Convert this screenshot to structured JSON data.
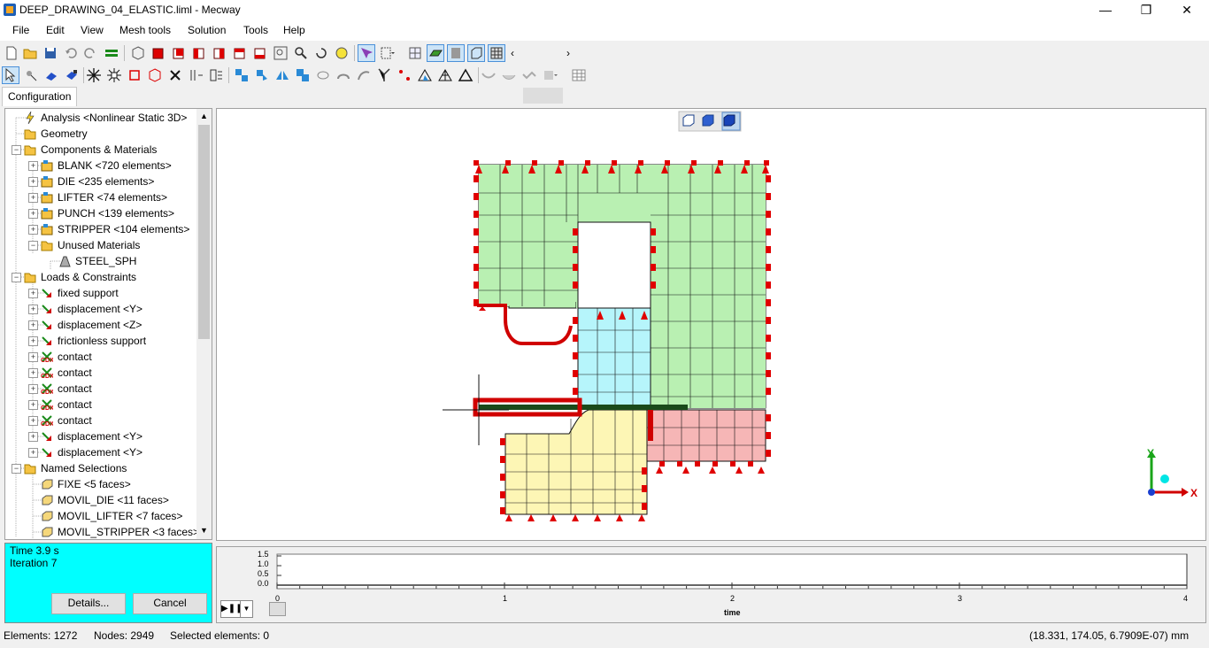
{
  "window": {
    "title": "DEEP_DRAWING_04_ELASTIC.liml - Mecway",
    "minimize": "—",
    "maximize": "❐",
    "close": "✕"
  },
  "menu": [
    "File",
    "Edit",
    "View",
    "Mesh tools",
    "Solution",
    "Tools",
    "Help"
  ],
  "tabs": {
    "configuration": "Configuration"
  },
  "tree": {
    "items": [
      {
        "label": "Analysis <Nonlinear Static 3D>",
        "icon": "lightning-icon"
      },
      {
        "label": "Geometry",
        "icon": "folder-icon"
      },
      {
        "label": "Components & Materials",
        "icon": "folder-components-icon"
      },
      {
        "label": "BLANK <720 elements>",
        "icon": "component-icon"
      },
      {
        "label": "DIE <235 elements>",
        "icon": "component-icon"
      },
      {
        "label": "LIFTER <74 elements>",
        "icon": "component-icon"
      },
      {
        "label": "PUNCH <139 elements>",
        "icon": "component-icon"
      },
      {
        "label": "STRIPPER <104 elements>",
        "icon": "component-icon"
      },
      {
        "label": "Unused Materials",
        "icon": "folder-icon"
      },
      {
        "label": "STEEL_SPH",
        "icon": "material-icon"
      },
      {
        "label": "Loads & Constraints",
        "icon": "folder-loads-icon"
      },
      {
        "label": "fixed support",
        "icon": "constraint-icon"
      },
      {
        "label": "displacement <Y>",
        "icon": "constraint-icon"
      },
      {
        "label": "displacement <Z>",
        "icon": "constraint-icon"
      },
      {
        "label": "frictionless support",
        "icon": "constraint-icon"
      },
      {
        "label": "contact",
        "icon": "contact-icon"
      },
      {
        "label": "contact",
        "icon": "contact-icon"
      },
      {
        "label": "contact",
        "icon": "contact-icon"
      },
      {
        "label": "contact",
        "icon": "contact-icon"
      },
      {
        "label": "contact",
        "icon": "contact-icon"
      },
      {
        "label": "displacement <Y>",
        "icon": "constraint-icon"
      },
      {
        "label": "displacement <Y>",
        "icon": "constraint-icon"
      },
      {
        "label": "Named Selections",
        "icon": "folder-selection-icon"
      },
      {
        "label": "FIXE <5 faces>",
        "icon": "selection-icon"
      },
      {
        "label": "MOVIL_DIE <11 faces>",
        "icon": "selection-icon"
      },
      {
        "label": "MOVIL_LIFTER <7 faces>",
        "icon": "selection-icon"
      },
      {
        "label": "MOVIL_STRIPPER <3 faces>",
        "icon": "selection-icon"
      }
    ]
  },
  "progress": {
    "time": "Time 3.9 s",
    "iteration": "Iteration 7",
    "details_label": "Details...",
    "cancel_label": "Cancel"
  },
  "timeline": {
    "y_ticks": [
      "1.5",
      "1.0",
      "0.5",
      "0.0"
    ],
    "x_ticks": [
      "0",
      "1",
      "2",
      "3",
      "4"
    ],
    "xlabel": "time"
  },
  "status": {
    "elements": "Elements: 1272",
    "nodes": "Nodes: 2949",
    "selected": "Selected elements: 0",
    "coords": "(18.331, 174.05, 6.7909E-07) mm"
  },
  "axes": {
    "x": "X",
    "y": "Y"
  },
  "colors": {
    "die": "#b9f0b2",
    "punch": "#b6f5fb",
    "blank_lower": "#fdf6b5",
    "stripper": "#f6b6b6",
    "constraint": "#e00000",
    "cyan_panel": "#00ffff"
  }
}
